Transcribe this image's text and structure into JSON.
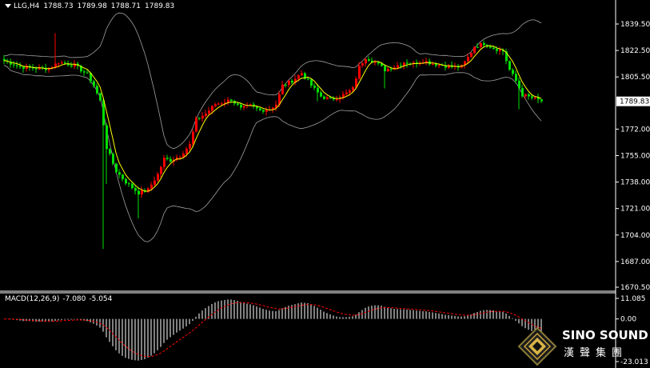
{
  "header": {
    "symbol": "LLG,H4",
    "open": "1788.73",
    "high": "1789.98",
    "low": "1788.71",
    "close": "1789.83"
  },
  "macd_header": {
    "label": "MACD(12,26,9)",
    "main": "-7.080",
    "signal": "-5.054"
  },
  "logo": {
    "title": "SINO SOUND",
    "subtitle": "漢聲集團"
  },
  "colors": {
    "background": "#000000",
    "bull": "#ff0000",
    "bear": "#00e000",
    "ma": "#ffff00",
    "bands": "#a0a0a0",
    "macd_hist": "#ffffff",
    "macd_signal": "#ff0000",
    "price_box": "#ffffff"
  },
  "chart_data": [
    {
      "type": "candlestick",
      "name": "price",
      "y_ticks": [
        "1839.50",
        "1822.50",
        "1805.50",
        "1789.83",
        "1772.00",
        "1755.00",
        "1738.00",
        "1721.00",
        "1704.00",
        "1687.00",
        "1670.50"
      ],
      "current_price": "1789.83",
      "ylim": [
        1668,
        1846
      ],
      "overlays": [
        "Bollinger Bands",
        "Moving Average"
      ],
      "grid": false
    },
    {
      "type": "bar",
      "name": "MACD",
      "y_ticks": [
        "11.085",
        "0.00",
        "-23.013"
      ],
      "ylim": [
        -23.013,
        11.085
      ],
      "series": [
        "histogram",
        "signal"
      ]
    }
  ]
}
